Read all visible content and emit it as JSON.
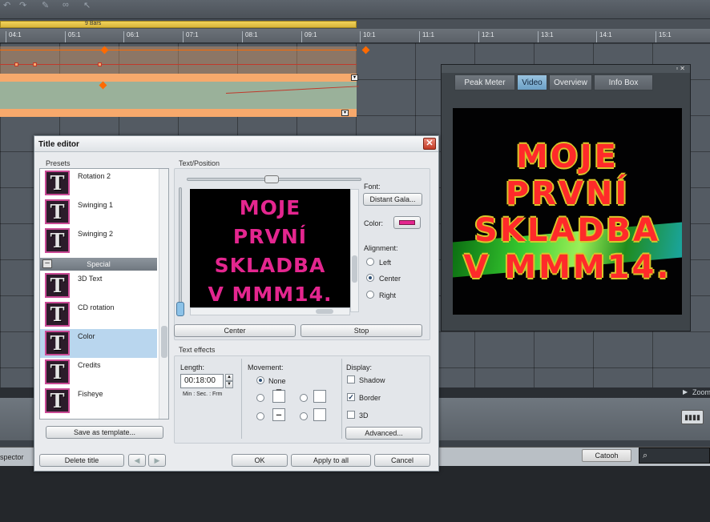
{
  "timeline": {
    "range_label": "9 Bars",
    "ruler_ticks": [
      "04:1",
      "05:1",
      "06:1",
      "07:1",
      "08:1",
      "09:1",
      "10:1",
      "11:1",
      "12:1",
      "13:1",
      "14:1",
      "15:1"
    ],
    "zoom_label": "Zoom"
  },
  "bottom": {
    "inspector_label": "spector",
    "catooh_button": "Catooh",
    "search_icon": "magnifier-icon"
  },
  "video_window": {
    "tabs": [
      {
        "label": "Peak Meter",
        "active": false
      },
      {
        "label": "Video",
        "active": true
      },
      {
        "label": "Overview",
        "active": false
      },
      {
        "label": "Info Box",
        "active": false
      }
    ],
    "screen_lines": [
      "MOJE",
      "PRVNÍ",
      "SKLADBA",
      "V MMM14."
    ],
    "text_color": "#ff2a2a",
    "outline_color": "#d7c72a"
  },
  "dialog": {
    "title": "Title editor",
    "presets_label": "Presets",
    "presets": [
      {
        "label": "Rotation 2"
      },
      {
        "label": "Swinging 1"
      },
      {
        "label": "Swinging 2"
      }
    ],
    "group": {
      "toggle": "–",
      "label": "Special"
    },
    "special_presets": [
      {
        "label": "3D Text",
        "selected": false
      },
      {
        "label": "CD rotation",
        "selected": false
      },
      {
        "label": "Color",
        "selected": true
      },
      {
        "label": "Credits",
        "selected": false
      },
      {
        "label": "Fisheye",
        "selected": false
      }
    ],
    "save_template": "Save as template...",
    "text_position_label": "Text/Position",
    "preview_lines": [
      "MOJE",
      "PRVNÍ",
      "SKLADBA",
      "V MMM14."
    ],
    "preview_text_color": "#e4268f",
    "font_label": "Font:",
    "font_button": "Distant Gala...",
    "color_label": "Color:",
    "alignment_label": "Alignment:",
    "alignment": [
      {
        "label": "Left",
        "selected": false
      },
      {
        "label": "Center",
        "selected": true
      },
      {
        "label": "Right",
        "selected": false
      }
    ],
    "center_button": "Center",
    "stop_button": "Stop",
    "text_effects_label": "Text effects",
    "length_label": "Length:",
    "length_value": "00:18:00",
    "length_hint": "Min : Sec. : Frm",
    "movement_label": "Movement:",
    "movement_none": "None",
    "display_label": "Display:",
    "display": [
      {
        "label": "Shadow",
        "checked": false
      },
      {
        "label": "Border",
        "checked": true
      },
      {
        "label": "3D",
        "checked": false
      }
    ],
    "advanced_button": "Advanced...",
    "delete_title": "Delete title",
    "ok": "OK",
    "apply_all": "Apply to all",
    "cancel": "Cancel"
  }
}
